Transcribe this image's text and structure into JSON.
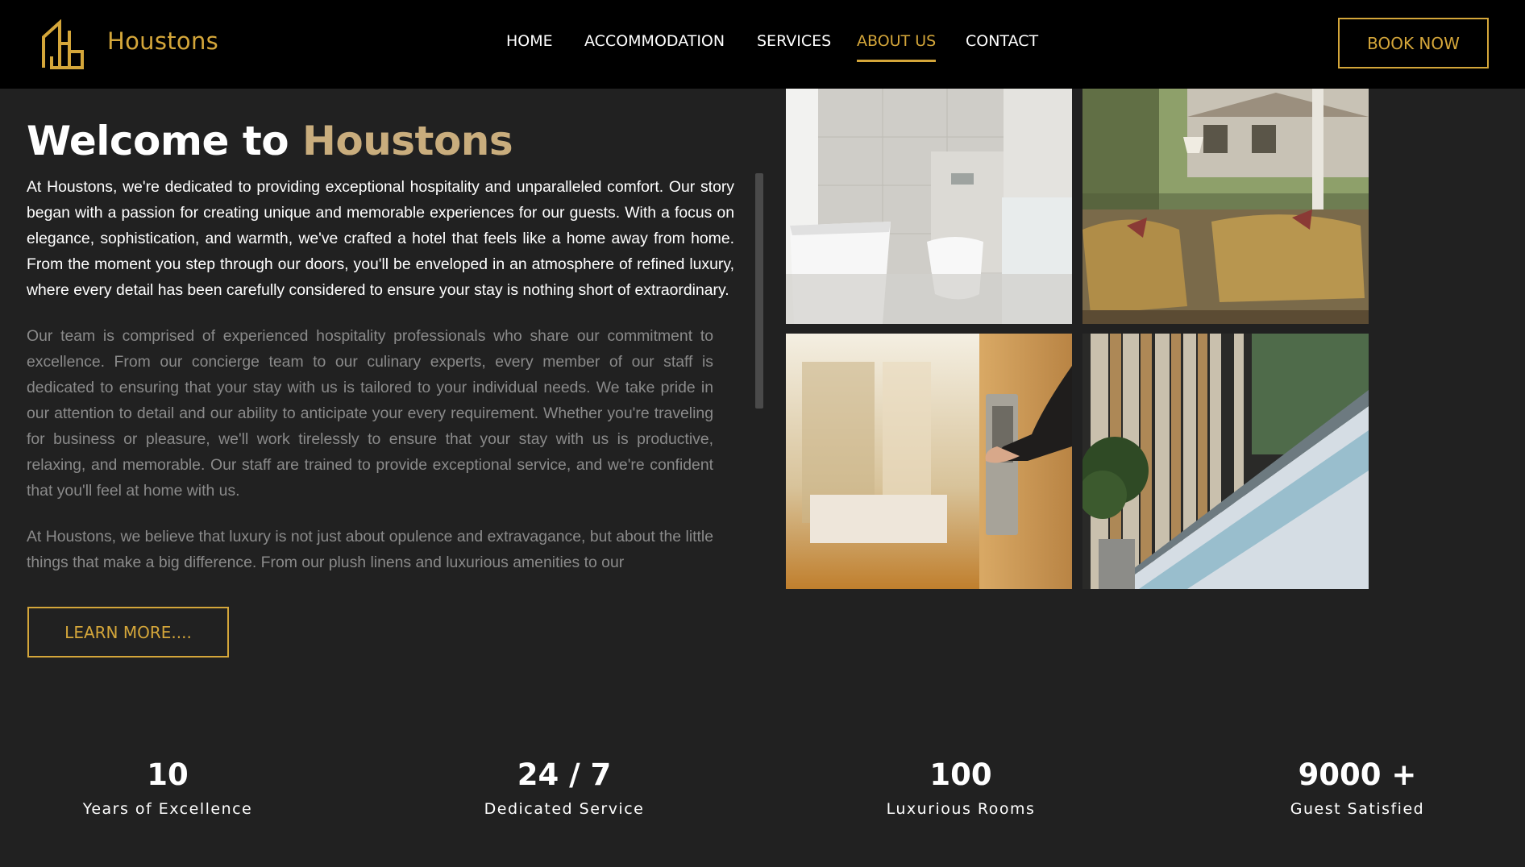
{
  "header": {
    "brand": "Houstons",
    "nav": [
      {
        "label": "HOME"
      },
      {
        "label": "ACCOMMODATION"
      },
      {
        "label": "SERVICES"
      },
      {
        "label": "ABOUT US",
        "active": true
      },
      {
        "label": "CONTACT"
      }
    ],
    "book_label": "BOOK NOW"
  },
  "about": {
    "title_prefix": "Welcome to ",
    "title_highlight": "Houstons",
    "paragraphs": [
      "At Houstons, we're dedicated to providing exceptional hospitality and unparalleled comfort. Our story began with a passion for creating unique and memorable experiences for our guests. With a focus on elegance, sophistication, and warmth, we've crafted a hotel that feels like a home away from home. From the moment you step through our doors, you'll be enveloped in an atmosphere of refined luxury, where every detail has been carefully considered to ensure your stay is nothing short of extraordinary.",
      "Our team is comprised of experienced hospitality professionals who share our commitment to excellence. From our concierge team to our culinary experts, every member of our staff is dedicated to ensuring that your stay with us is tailored to your individual needs. We take pride in our attention to detail and our ability to anticipate your every requirement. Whether you're traveling for business or pleasure, we'll work tirelessly to ensure that your stay with us is productive, relaxing, and memorable. Our staff are trained to provide exceptional service, and we're confident that you'll feel at home with us.",
      "At Houstons, we believe that luxury is not just about opulence and extravagance, but about the little things that make a big difference. From our plush linens and luxurious amenities to our"
    ],
    "learn_more_label": "LEARN MORE...."
  },
  "stats": [
    {
      "value": "10",
      "label": "Years of Excellence"
    },
    {
      "value": "24 / 7",
      "label": "Dedicated Service"
    },
    {
      "value": "100",
      "label": "Luxurious Rooms"
    },
    {
      "value": "9000 +",
      "label": "Guest Satisfied"
    }
  ],
  "colors": {
    "accent": "#d4a63a",
    "title_highlight": "#c9ad7d",
    "background": "#212121",
    "header_bg": "#000000"
  }
}
